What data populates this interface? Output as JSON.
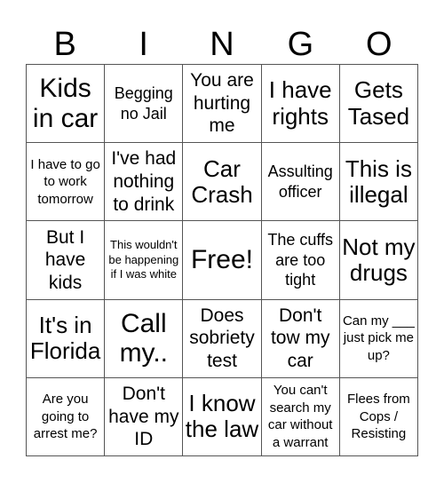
{
  "header": {
    "letters": [
      "B",
      "I",
      "N",
      "G",
      "O"
    ]
  },
  "cells": [
    "Kids in car",
    "Begging no Jail",
    "You are hurting me",
    "I have rights",
    "Gets Tased",
    "I have to go to work tomorrow",
    "I've had nothing to drink",
    "Car Crash",
    "Assulting officer",
    "This is illegal",
    "But I have kids",
    "This wouldn't be happening if I was white",
    "Free!",
    "The cuffs are too tight",
    "Not my drugs",
    "It's in Florida",
    "Call my..",
    "Does sobriety test",
    "Don't tow my car",
    "Can my ___ just pick me up?",
    "Are you going to arrest me?",
    "Don't have my ID",
    "I know the law",
    "You can't search my car without a warrant",
    "Flees from Cops / Resisting"
  ]
}
